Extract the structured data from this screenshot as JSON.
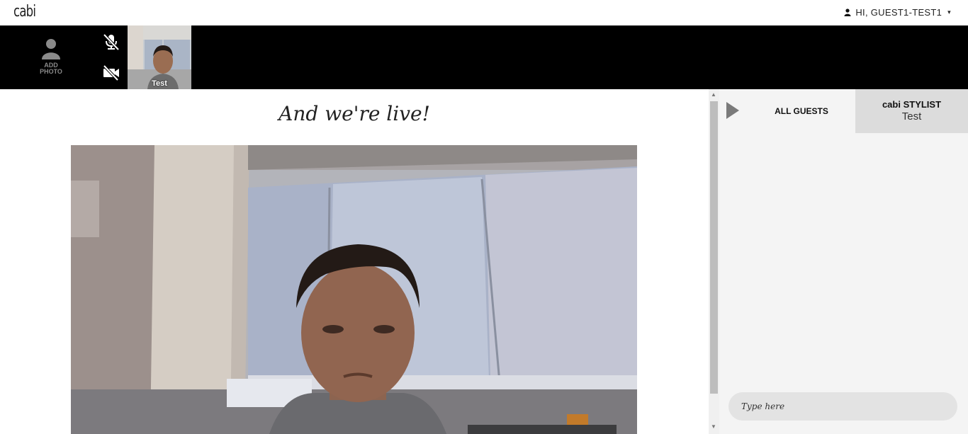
{
  "header": {
    "logo_text": "cabi",
    "greeting": "HI, GUEST1-TEST1",
    "caret": "▾"
  },
  "strip": {
    "add_photo_line1": "ADD",
    "add_photo_line2": "PHOTO",
    "participant_name": "Test",
    "mic_state": "muted",
    "camera_state": "off"
  },
  "main": {
    "headline": "And we're live!"
  },
  "chat": {
    "tab_all_guests": "ALL GUESTS",
    "tab_stylist_title": "cabi STYLIST",
    "tab_stylist_name": "Test",
    "input_placeholder": "Type here"
  },
  "colors": {
    "strip_bg": "#000000",
    "chat_bg": "#f4f4f4",
    "stylist_tab_bg": "#dcdcdc"
  }
}
